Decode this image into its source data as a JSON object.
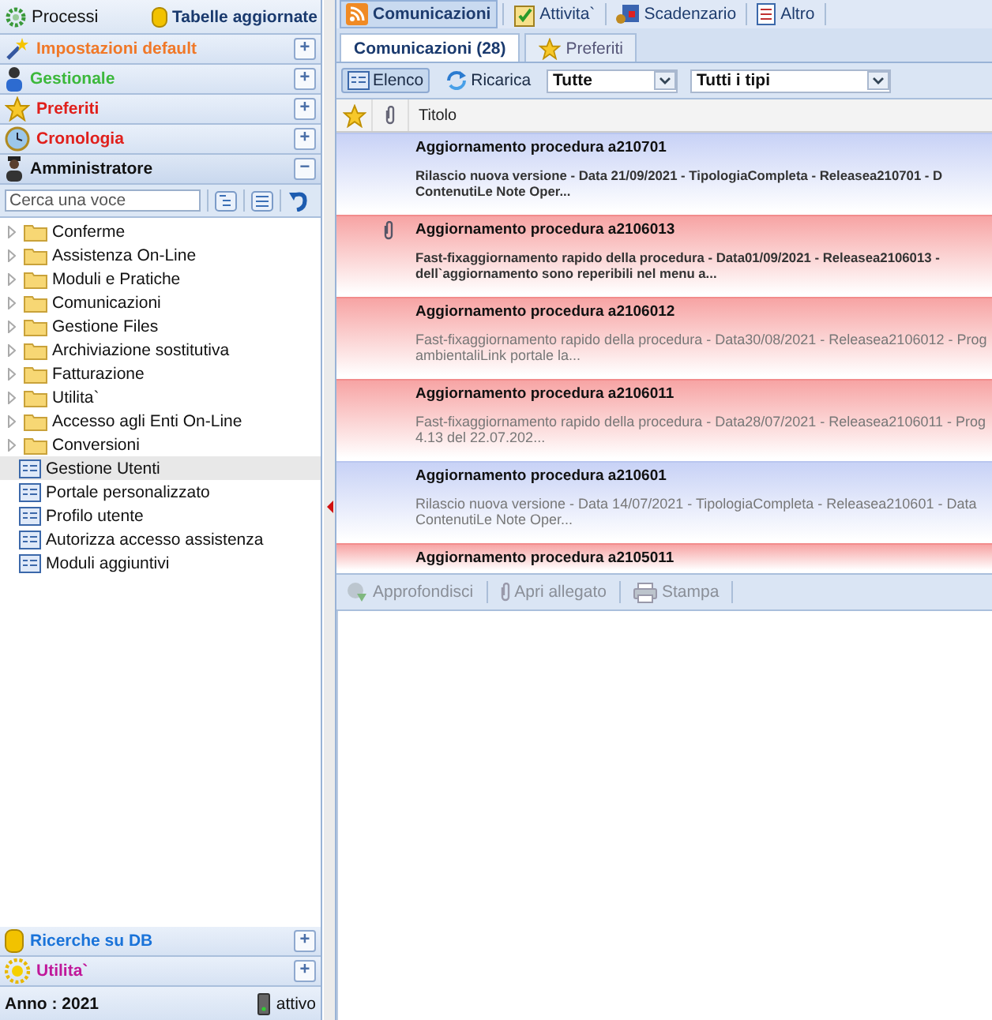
{
  "left_top": {
    "processes": "Processi",
    "tables": "Tabelle aggiornate"
  },
  "sections_top": [
    {
      "label": "Impostazioni default",
      "color": "#f07828",
      "kind": "wand",
      "expanded": false,
      "toggle": "+"
    },
    {
      "label": "Gestionale",
      "color": "#3cb83c",
      "kind": "person",
      "expanded": false,
      "toggle": "+"
    },
    {
      "label": "Preferiti",
      "color": "#e0201c",
      "kind": "star",
      "expanded": false,
      "toggle": "+"
    },
    {
      "label": "Cronologia",
      "color": "#e0201c",
      "kind": "clock",
      "expanded": false,
      "toggle": "+"
    },
    {
      "label": "Amministratore",
      "color": "#111111",
      "kind": "admin",
      "expanded": true,
      "toggle": "−"
    }
  ],
  "search": {
    "placeholder": "Cerca una voce"
  },
  "tree": [
    {
      "kind": "folder",
      "label": "Conferme",
      "selected": false
    },
    {
      "kind": "folder",
      "label": "Assistenza On-Line",
      "selected": false
    },
    {
      "kind": "folder",
      "label": "Moduli e Pratiche",
      "selected": false
    },
    {
      "kind": "folder",
      "label": "Comunicazioni",
      "selected": false
    },
    {
      "kind": "folder",
      "label": "Gestione Files",
      "selected": false
    },
    {
      "kind": "folder",
      "label": "Archiviazione sostitutiva",
      "selected": false
    },
    {
      "kind": "folder",
      "label": "Fatturazione",
      "selected": false
    },
    {
      "kind": "folder",
      "label": "Utilita`",
      "selected": false
    },
    {
      "kind": "folder",
      "label": "Accesso agli Enti On-Line",
      "selected": false
    },
    {
      "kind": "folder",
      "label": "Conversioni",
      "selected": false
    },
    {
      "kind": "page",
      "label": "Gestione Utenti",
      "selected": true
    },
    {
      "kind": "page",
      "label": "Portale personalizzato",
      "selected": false
    },
    {
      "kind": "page",
      "label": "Profilo utente",
      "selected": false
    },
    {
      "kind": "page",
      "label": "Autorizza accesso assistenza",
      "selected": false
    },
    {
      "kind": "page",
      "label": "Moduli aggiuntivi",
      "selected": false
    }
  ],
  "sections_bottom": [
    {
      "label": "Ricerche su DB",
      "color": "#1a73d9",
      "kind": "database",
      "expanded": false,
      "toggle": "+"
    },
    {
      "label": "Utilita`",
      "color": "#c0189a",
      "kind": "sun",
      "expanded": false,
      "toggle": "+"
    }
  ],
  "status": {
    "year": "Anno : 2021",
    "state": "attivo"
  },
  "main_tabs": [
    {
      "label": "Comunicazioni",
      "kind": "feed",
      "selected": true
    },
    {
      "label": "Attivita`",
      "kind": "tasks",
      "selected": false
    },
    {
      "label": "Scadenzario",
      "kind": "deadlines",
      "selected": false
    },
    {
      "label": "Altro",
      "kind": "other",
      "selected": false
    }
  ],
  "sub_tabs": [
    {
      "label": "Comunicazioni (28)",
      "selected": true
    },
    {
      "label": "Preferiti",
      "selected": false
    }
  ],
  "toolbar": {
    "list_button": {
      "label": "Elenco",
      "pressed": true
    },
    "reload": "Ricarica",
    "filter_1": "Tutte",
    "filter_2": "Tutti i tipi"
  },
  "table": {
    "columns": [
      "Titolo"
    ],
    "rows": [
      {
        "kind": "info",
        "attachment": false,
        "unread": true,
        "title": "Aggiornamento procedura a210701",
        "desc": [
          "Rilascio nuova versione - Data 21/09/2021 - TipologiaCompleta - Releasea210701 - D",
          "ContenutiLe Note Oper..."
        ]
      },
      {
        "kind": "urgent",
        "attachment": true,
        "unread": true,
        "title": "Aggiornamento procedura a2106013",
        "desc": [
          "Fast-fixaggiornamento rapido della procedura - Data01/09/2021 - Releasea2106013 -",
          "dell`aggiornamento sono reperibili nel menu a..."
        ]
      },
      {
        "kind": "urgent",
        "attachment": false,
        "unread": false,
        "title": "Aggiornamento procedura a2106012",
        "desc": [
          "Fast-fixaggiornamento rapido della procedura - Data30/08/2021 - Releasea2106012 - Prog",
          "ambientaliLink portale la..."
        ]
      },
      {
        "kind": "urgent",
        "attachment": false,
        "unread": false,
        "title": "Aggiornamento procedura a2106011",
        "desc": [
          "Fast-fixaggiornamento rapido della procedura - Data28/07/2021 - Releasea2106011 - Prog",
          "4.13 del 22.07.202..."
        ]
      },
      {
        "kind": "info",
        "attachment": false,
        "unread": false,
        "title": "Aggiornamento procedura a210601",
        "desc": [
          "Rilascio nuova versione - Data 14/07/2021 - TipologiaCompleta - Releasea210601 - Data",
          "ContenutiLe Note Oper..."
        ]
      },
      {
        "kind": "urgent",
        "attachment": false,
        "title": "Aggiornamento procedura a2105011",
        "desc": []
      }
    ]
  },
  "bottom_toolbar": [
    {
      "label": "Approfondisci",
      "kind": "details",
      "disabled": true
    },
    {
      "label": "Apri allegato",
      "kind": "attachment",
      "disabled": true
    },
    {
      "label": "Stampa",
      "kind": "print",
      "disabled": true
    }
  ]
}
